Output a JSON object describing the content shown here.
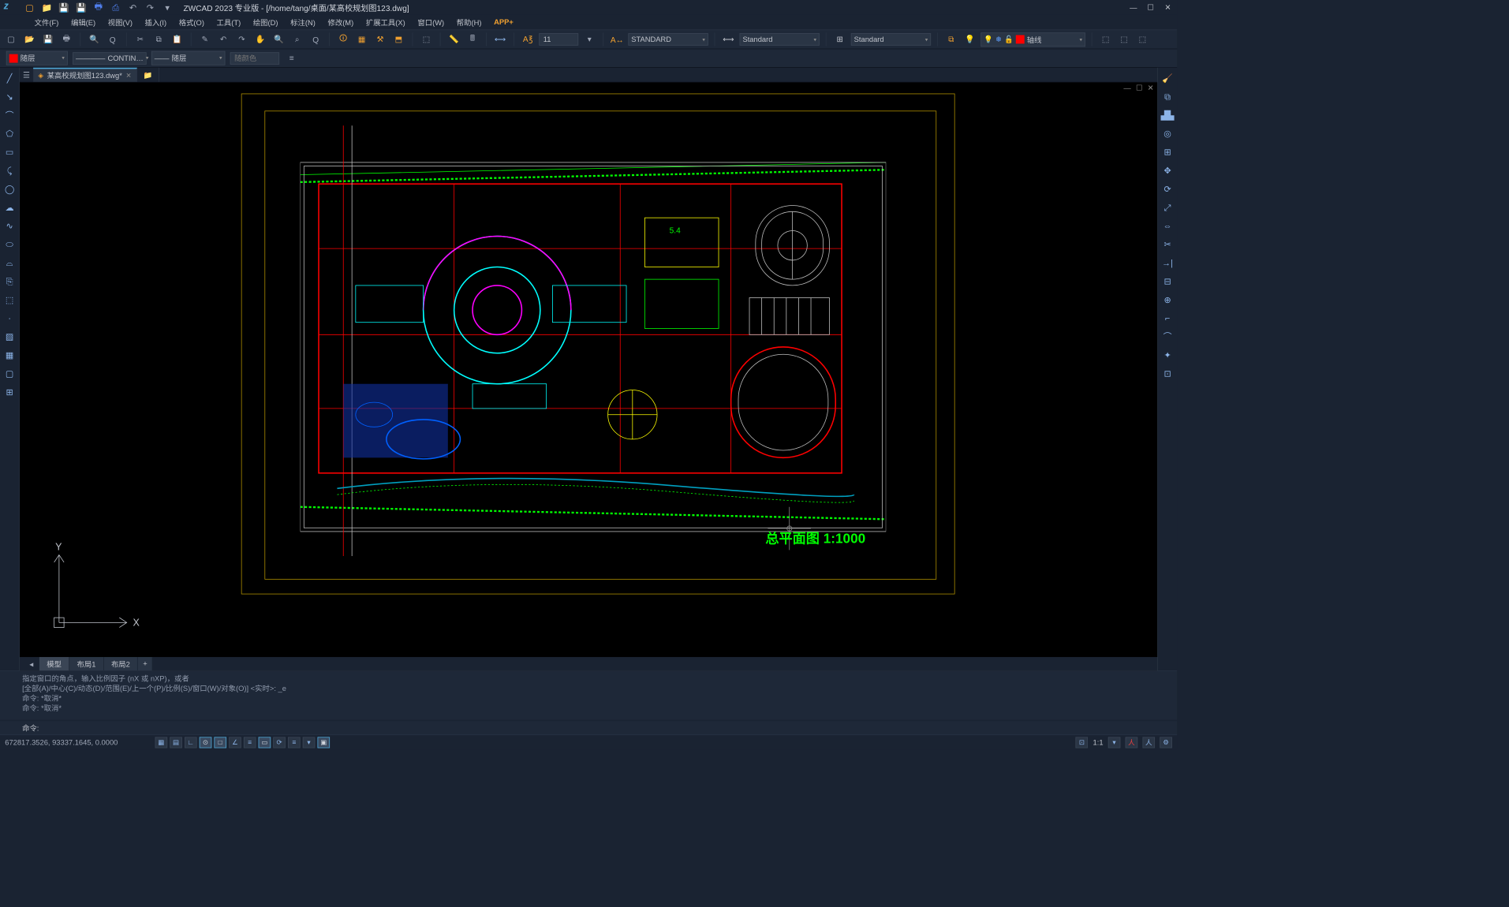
{
  "title": "ZWCAD 2023 专业版 - [/home/tang/桌面/某高校规划图123.dwg]",
  "logo_text": "z",
  "menubar": [
    "文件(F)",
    "编辑(E)",
    "视图(V)",
    "插入(I)",
    "格式(O)",
    "工具(T)",
    "绘图(D)",
    "标注(N)",
    "修改(M)",
    "扩展工具(X)",
    "窗口(W)",
    "帮助(H)"
  ],
  "app_plus": "APP+",
  "toolbar1": {
    "annotation_value": "11",
    "text_style": "STANDARD",
    "dim_style": "Standard",
    "table_style": "Standard",
    "layer_style_label": "轴线"
  },
  "toolbar2": {
    "layer_color_label": "随层",
    "linetype": "CONTIN…",
    "lineweight_label": "随层",
    "color_placeholder": "随颜色"
  },
  "doc_tab": {
    "name": "某高校规划图123.dwg*"
  },
  "plan_label": "总平面图 1:1000",
  "layout_tabs": [
    "模型",
    "布局1",
    "布局2"
  ],
  "command_history": [
    "指定窗口的角点，输入比例因子 (nX 或 nXP)，或者",
    "[全部(A)/中心(C)/动态(D)/范围(E)/上一个(P)/比例(S)/窗口(W)/对象(O)] <实时>:  _e",
    "命令: *取消*",
    "命令: *取消*"
  ],
  "command_prompt": "命令:",
  "status": {
    "coords": "672817.3526, 93337.1645, 0.0000",
    "zoom": "1:1"
  },
  "ucs": {
    "x": "X",
    "y": "Y"
  }
}
